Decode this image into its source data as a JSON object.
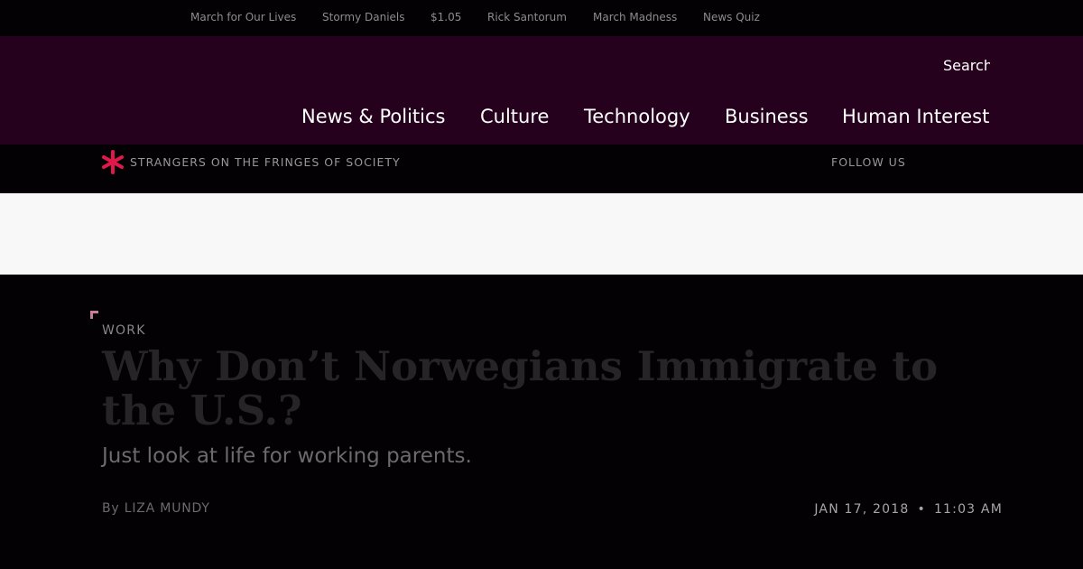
{
  "trending": [
    "March for Our Lives",
    "Stormy Daniels",
    "$1.05",
    "Rick Santorum",
    "March Madness",
    "News Quiz"
  ],
  "header": {
    "search_label": "Search",
    "nav": [
      "News & Politics",
      "Culture",
      "Technology",
      "Business",
      "Human Interest"
    ]
  },
  "section_bar": {
    "logo_icon": "asterisk-logo-icon",
    "section_title": "STRANGERS ON THE FRINGES OF SOCIETY",
    "follow_label": "FOLLOW US",
    "accent_color": "#e0194a"
  },
  "article": {
    "kicker": "WORK",
    "headline": "Why Don’t Norwegians Immigrate to the U.S.?",
    "dek": "Just look at life for working parents.",
    "byline_prefix": "By",
    "author": "LIZA MUNDY",
    "date": "JAN 17, 2018",
    "separator": "•",
    "time": "11:03 AM"
  }
}
